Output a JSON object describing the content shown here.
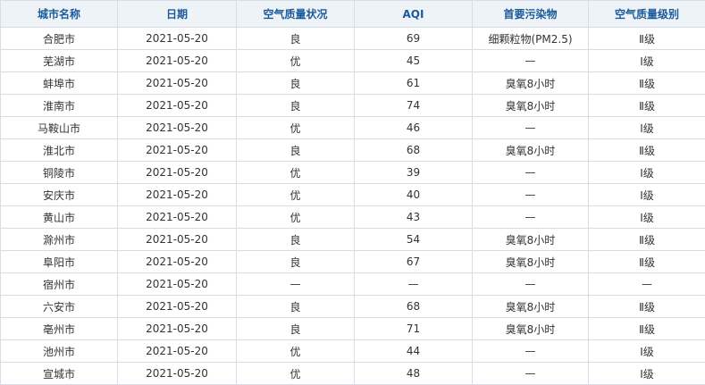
{
  "table": {
    "headers": [
      "城市名称",
      "日期",
      "空气质量状况",
      "AQI",
      "首要污染物",
      "空气质量级别"
    ],
    "rows": [
      [
        "合肥市",
        "2021-05-20",
        "良",
        "69",
        "细颗粒物(PM2.5)",
        "Ⅱ级"
      ],
      [
        "芜湖市",
        "2021-05-20",
        "优",
        "45",
        "—",
        "Ⅰ级"
      ],
      [
        "蚌埠市",
        "2021-05-20",
        "良",
        "61",
        "臭氧8小时",
        "Ⅱ级"
      ],
      [
        "淮南市",
        "2021-05-20",
        "良",
        "74",
        "臭氧8小时",
        "Ⅱ级"
      ],
      [
        "马鞍山市",
        "2021-05-20",
        "优",
        "46",
        "—",
        "Ⅰ级"
      ],
      [
        "淮北市",
        "2021-05-20",
        "良",
        "68",
        "臭氧8小时",
        "Ⅱ级"
      ],
      [
        "铜陵市",
        "2021-05-20",
        "优",
        "39",
        "—",
        "Ⅰ级"
      ],
      [
        "安庆市",
        "2021-05-20",
        "优",
        "40",
        "—",
        "Ⅰ级"
      ],
      [
        "黄山市",
        "2021-05-20",
        "优",
        "43",
        "—",
        "Ⅰ级"
      ],
      [
        "滁州市",
        "2021-05-20",
        "良",
        "54",
        "臭氧8小时",
        "Ⅱ级"
      ],
      [
        "阜阳市",
        "2021-05-20",
        "良",
        "67",
        "臭氧8小时",
        "Ⅱ级"
      ],
      [
        "宿州市",
        "2021-05-20",
        "—",
        "—",
        "—",
        "—"
      ],
      [
        "六安市",
        "2021-05-20",
        "良",
        "68",
        "臭氧8小时",
        "Ⅱ级"
      ],
      [
        "亳州市",
        "2021-05-20",
        "良",
        "71",
        "臭氧8小时",
        "Ⅱ级"
      ],
      [
        "池州市",
        "2021-05-20",
        "优",
        "44",
        "—",
        "Ⅰ级"
      ],
      [
        "宣城市",
        "2021-05-20",
        "优",
        "48",
        "—",
        "Ⅰ级"
      ]
    ]
  }
}
